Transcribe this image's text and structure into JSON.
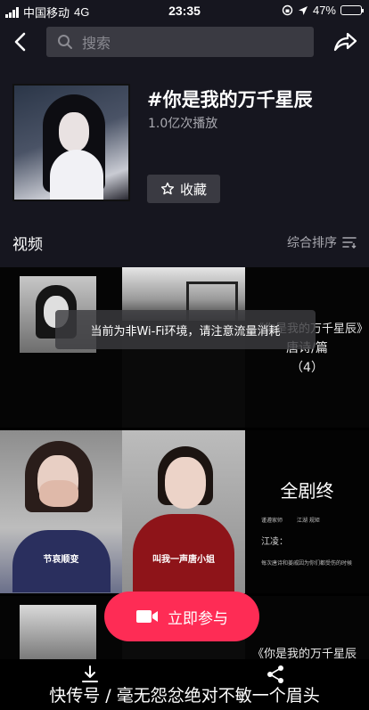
{
  "status_bar": {
    "carrier": "中国移动",
    "network": "4G",
    "time": "23:35",
    "battery": "47%",
    "battery_level": 0.47
  },
  "header": {
    "search_placeholder": "搜索"
  },
  "topic": {
    "title": "#你是我的万千星辰",
    "play_count": "1.0亿次播放",
    "favorite_label": "收藏"
  },
  "videos_section": {
    "title": "视频",
    "sort_label": "综合排序"
  },
  "toast": {
    "text": "当前为非Wi-Fi环境，请注意流量消耗"
  },
  "grid": {
    "c3_title": "《你是我的万千星辰》",
    "c3_sub": "唐诗/篇",
    "c3_num": "（4）",
    "c4_caption": "节哀顺变",
    "c5_caption": "叫我一声唐小姐",
    "c6_title": "全剧终",
    "c6_line1": "谨遵家师",
    "c6_line2": "江湖 规矩",
    "c6_name": "江凌：",
    "c6_text": "每次唐诗和姜戚因为你们都受伤的时候",
    "c9_title": "《你是我的万千星辰"
  },
  "join_button": {
    "label": "立即参与"
  },
  "bottom": {
    "watermark": "快传号 / 毫无怨忿绝对不敏一个眉头"
  },
  "colors": {
    "accent": "#fe2c55",
    "header_bg": "#16161f",
    "search_bg": "#3a3a42"
  }
}
